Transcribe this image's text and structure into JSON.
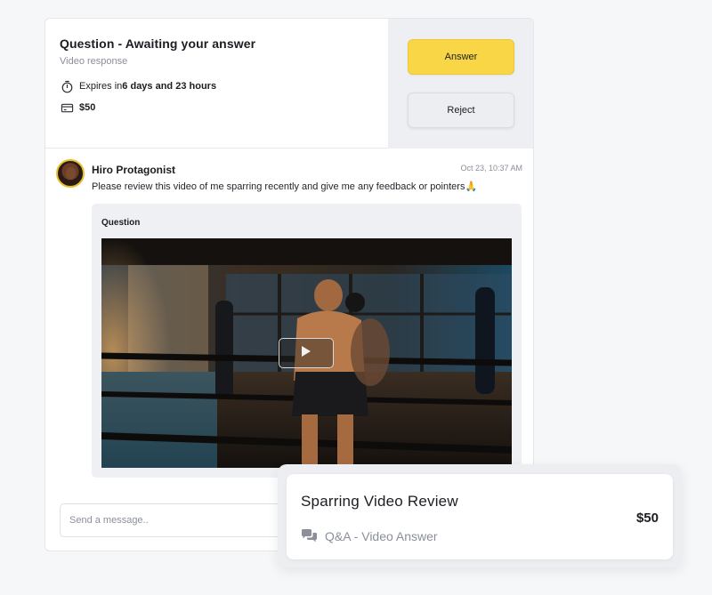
{
  "question": {
    "title": "Question - Awaiting your answer",
    "subtitle": "Video response",
    "expires_prefix": "Expires in ",
    "expires_value": "6 days and 23 hours",
    "price": "$50"
  },
  "actions": {
    "answer_label": "Answer",
    "reject_label": "Reject"
  },
  "message": {
    "sender": "Hiro Protagonist",
    "timestamp": "Oct 23, 10:37 AM",
    "text": "Please review this video of me sparring recently and give me any feedback or pointers🙏",
    "attachment_label": "Question"
  },
  "composer": {
    "placeholder": "Send a message.."
  },
  "summary": {
    "title": "Sparring Video Review",
    "subtitle": "Q&A - Video Answer",
    "price": "$50"
  },
  "icons": {
    "timer": "stopwatch-icon",
    "price": "card-icon",
    "play": "play-icon",
    "chat": "chat-bubbles-icon"
  },
  "colors": {
    "accent": "#f8d646",
    "avatar_ring": "#e8bf2a"
  }
}
